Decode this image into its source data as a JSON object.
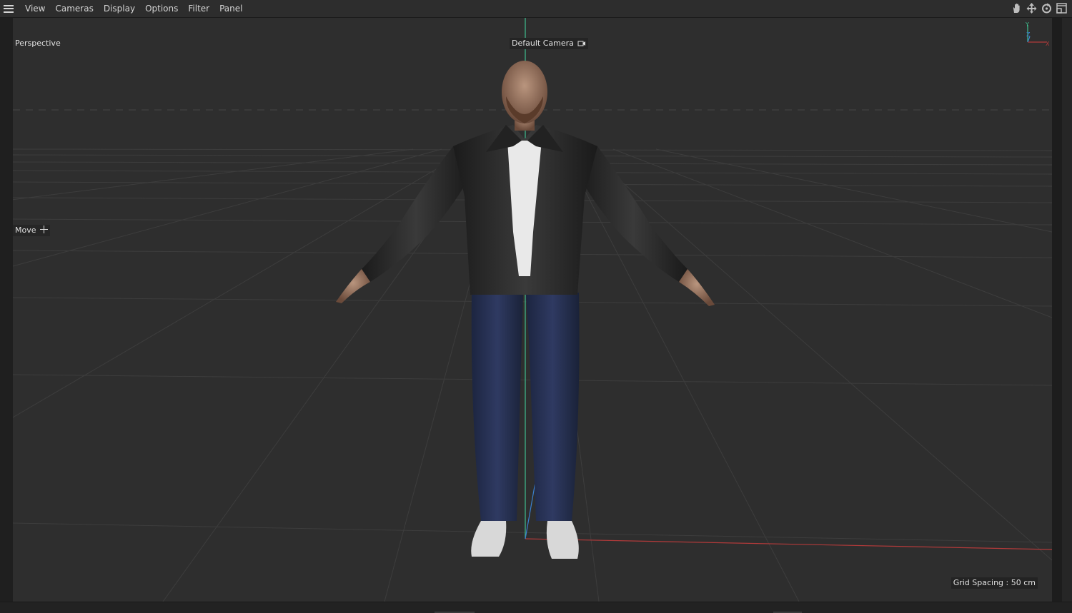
{
  "menu": {
    "items": [
      "View",
      "Cameras",
      "Display",
      "Options",
      "Filter",
      "Panel"
    ]
  },
  "toolbar_icons": [
    "hand-pan-icon",
    "move-arrows-icon",
    "rotate-icon",
    "maximize-panel-icon"
  ],
  "viewport": {
    "projection_label": "Perspective",
    "camera_label": "Default Camera",
    "tool_label": "Move",
    "grid_spacing": "Grid Spacing : 50 cm",
    "axis_gizmo": {
      "y_label": "Y",
      "z_label": "Z",
      "x_label": "X"
    }
  },
  "colors": {
    "background": "#2e2e2e",
    "grid_line": "#3e3e3e",
    "x_axis": "#b13a3a",
    "y_axis": "#3fbf8f",
    "z_axis": "#3a7fd0"
  }
}
